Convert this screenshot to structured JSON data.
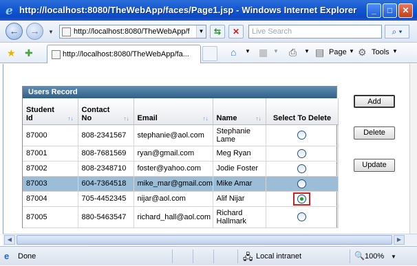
{
  "window": {
    "title": "http://localhost:8080/TheWebApp/faces/Page1.jsp - Windows Internet Explorer",
    "minimize_glyph": "_",
    "maximize_glyph": "□",
    "close_glyph": "✕"
  },
  "address_bar": {
    "url": "http://localhost:8080/TheWebApp/f",
    "search_placeholder": "Live Search"
  },
  "tab": {
    "title": "http://localhost:8080/TheWebApp/fa..."
  },
  "command_bar": {
    "page_label": "Page",
    "tools_label": "Tools"
  },
  "table": {
    "title": "Users Record",
    "columns": [
      {
        "label": "Student\nId",
        "sortable": true
      },
      {
        "label": "Contact\nNo",
        "sortable": true
      },
      {
        "label": "Email",
        "sortable": true
      },
      {
        "label": "Name",
        "sortable": true
      },
      {
        "label": "Select To Delete",
        "sortable": false
      }
    ],
    "rows": [
      {
        "id": "87000",
        "contact": "808-2341567",
        "email": "stephanie@aol.com",
        "name": "Stephanie\nLame",
        "checked": false,
        "selected": false
      },
      {
        "id": "87001",
        "contact": "808-7681569",
        "email": "ryan@gmail.com",
        "name": "Meg Ryan",
        "checked": false,
        "selected": false
      },
      {
        "id": "87002",
        "contact": "808-2348710",
        "email": "foster@yahoo.com",
        "name": "Jodie Foster",
        "checked": false,
        "selected": false
      },
      {
        "id": "87003",
        "contact": "604-7364518",
        "email": "mike_mar@gmail.com",
        "name": "Mike Amar",
        "checked": false,
        "selected": true
      },
      {
        "id": "87004",
        "contact": "705-4452345",
        "email": "nijar@aol.com",
        "name": "Alif Nijar",
        "checked": true,
        "selected": false
      },
      {
        "id": "87005",
        "contact": "880-5463547",
        "email": "richard_hall@aol.com",
        "name": "Richard\nHallmark",
        "checked": false,
        "selected": false
      }
    ]
  },
  "buttons": {
    "add": "Add",
    "delete": "Delete",
    "update": "Update"
  },
  "status_bar": {
    "status": "Done",
    "zone": "Local intranet",
    "zoom": "100%"
  },
  "colors": {
    "titlebar": "#0b48c4",
    "panel_header": "#2f5f88",
    "selected_row": "#9bbdd6",
    "radio_checked": "#21a121",
    "highlight_box": "#d12020"
  }
}
